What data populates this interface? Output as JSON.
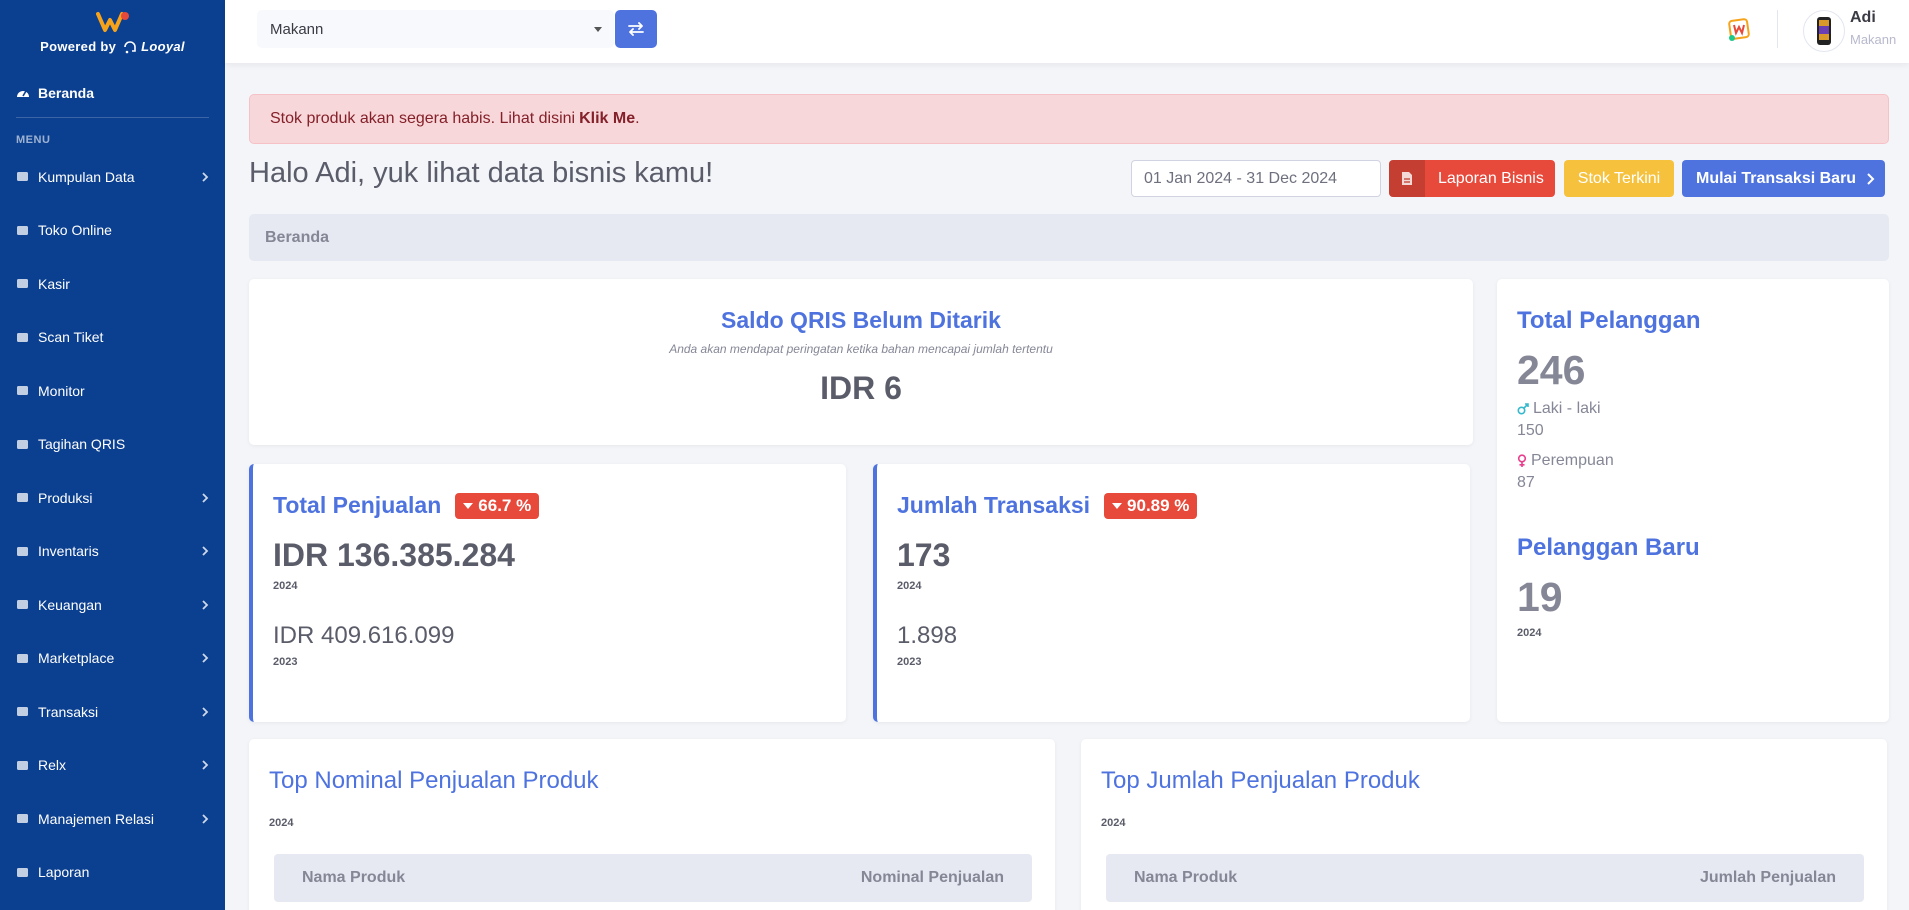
{
  "brand": {
    "powered_by": "Powered by",
    "partner": "Looyal"
  },
  "sidebar": {
    "home": "Beranda",
    "heading": "MENU",
    "items": [
      {
        "label": "Kumpulan Data",
        "has_children": true
      },
      {
        "label": "Toko Online",
        "has_children": false
      },
      {
        "label": "Kasir",
        "has_children": false
      },
      {
        "label": "Scan Tiket",
        "has_children": false
      },
      {
        "label": "Monitor",
        "has_children": false
      },
      {
        "label": "Tagihan QRIS",
        "has_children": false
      },
      {
        "label": "Produksi",
        "has_children": true
      },
      {
        "label": "Inventaris",
        "has_children": true
      },
      {
        "label": "Keuangan",
        "has_children": true
      },
      {
        "label": "Marketplace",
        "has_children": true
      },
      {
        "label": "Transaksi",
        "has_children": true
      },
      {
        "label": "Relx",
        "has_children": true
      },
      {
        "label": "Manajemen Relasi",
        "has_children": true
      },
      {
        "label": "Laporan",
        "has_children": false
      }
    ]
  },
  "topbar": {
    "business_selected": "Makann",
    "user_name": "Adi",
    "user_business": "Makann"
  },
  "alert": {
    "text": "Stok produk akan segera habis. Lihat disini",
    "link": "Klik Me",
    "suffix": "."
  },
  "greeting": "Halo Adi, yuk lihat data bisnis kamu!",
  "date_range": "01 Jan 2024 - 31 Dec 2024",
  "buttons": {
    "report": "Laporan Bisnis",
    "stock": "Stok Terkini",
    "new_tx": "Mulai Transaksi Baru"
  },
  "breadcrumb": "Beranda",
  "qris": {
    "title": "Saldo QRIS Belum Ditarik",
    "subtitle": "Anda akan mendapat peringatan ketika bahan mencapai jumlah tertentu",
    "value": "IDR 6"
  },
  "sales": {
    "title": "Total Penjualan",
    "badge": "66.7 %",
    "current": "IDR 136.385.284",
    "current_year": "2024",
    "previous": "IDR 409.616.099",
    "previous_year": "2023"
  },
  "transactions": {
    "title": "Jumlah Transaksi",
    "badge": "90.89 %",
    "current": "173",
    "current_year": "2024",
    "previous": "1.898",
    "previous_year": "2023"
  },
  "customers": {
    "title": "Total Pelanggan",
    "total": "246",
    "male_label": "Laki - laki",
    "male": "150",
    "female_label": "Perempuan",
    "female": "87",
    "new_title": "Pelanggan Baru",
    "new_total": "19",
    "new_year": "2024"
  },
  "top_nominal": {
    "title": "Top Nominal Penjualan Produk",
    "year": "2024",
    "col1": "Nama Produk",
    "col2": "Nominal Penjualan"
  },
  "top_qty": {
    "title": "Top Jumlah Penjualan Produk",
    "year": "2024",
    "col1": "Nama Produk",
    "col2": "Jumlah Penjualan"
  },
  "colors": {
    "sidebar": "#0b3f8f",
    "primary": "#4e73df",
    "danger": "#e74a3b",
    "warning": "#f6c23e"
  }
}
